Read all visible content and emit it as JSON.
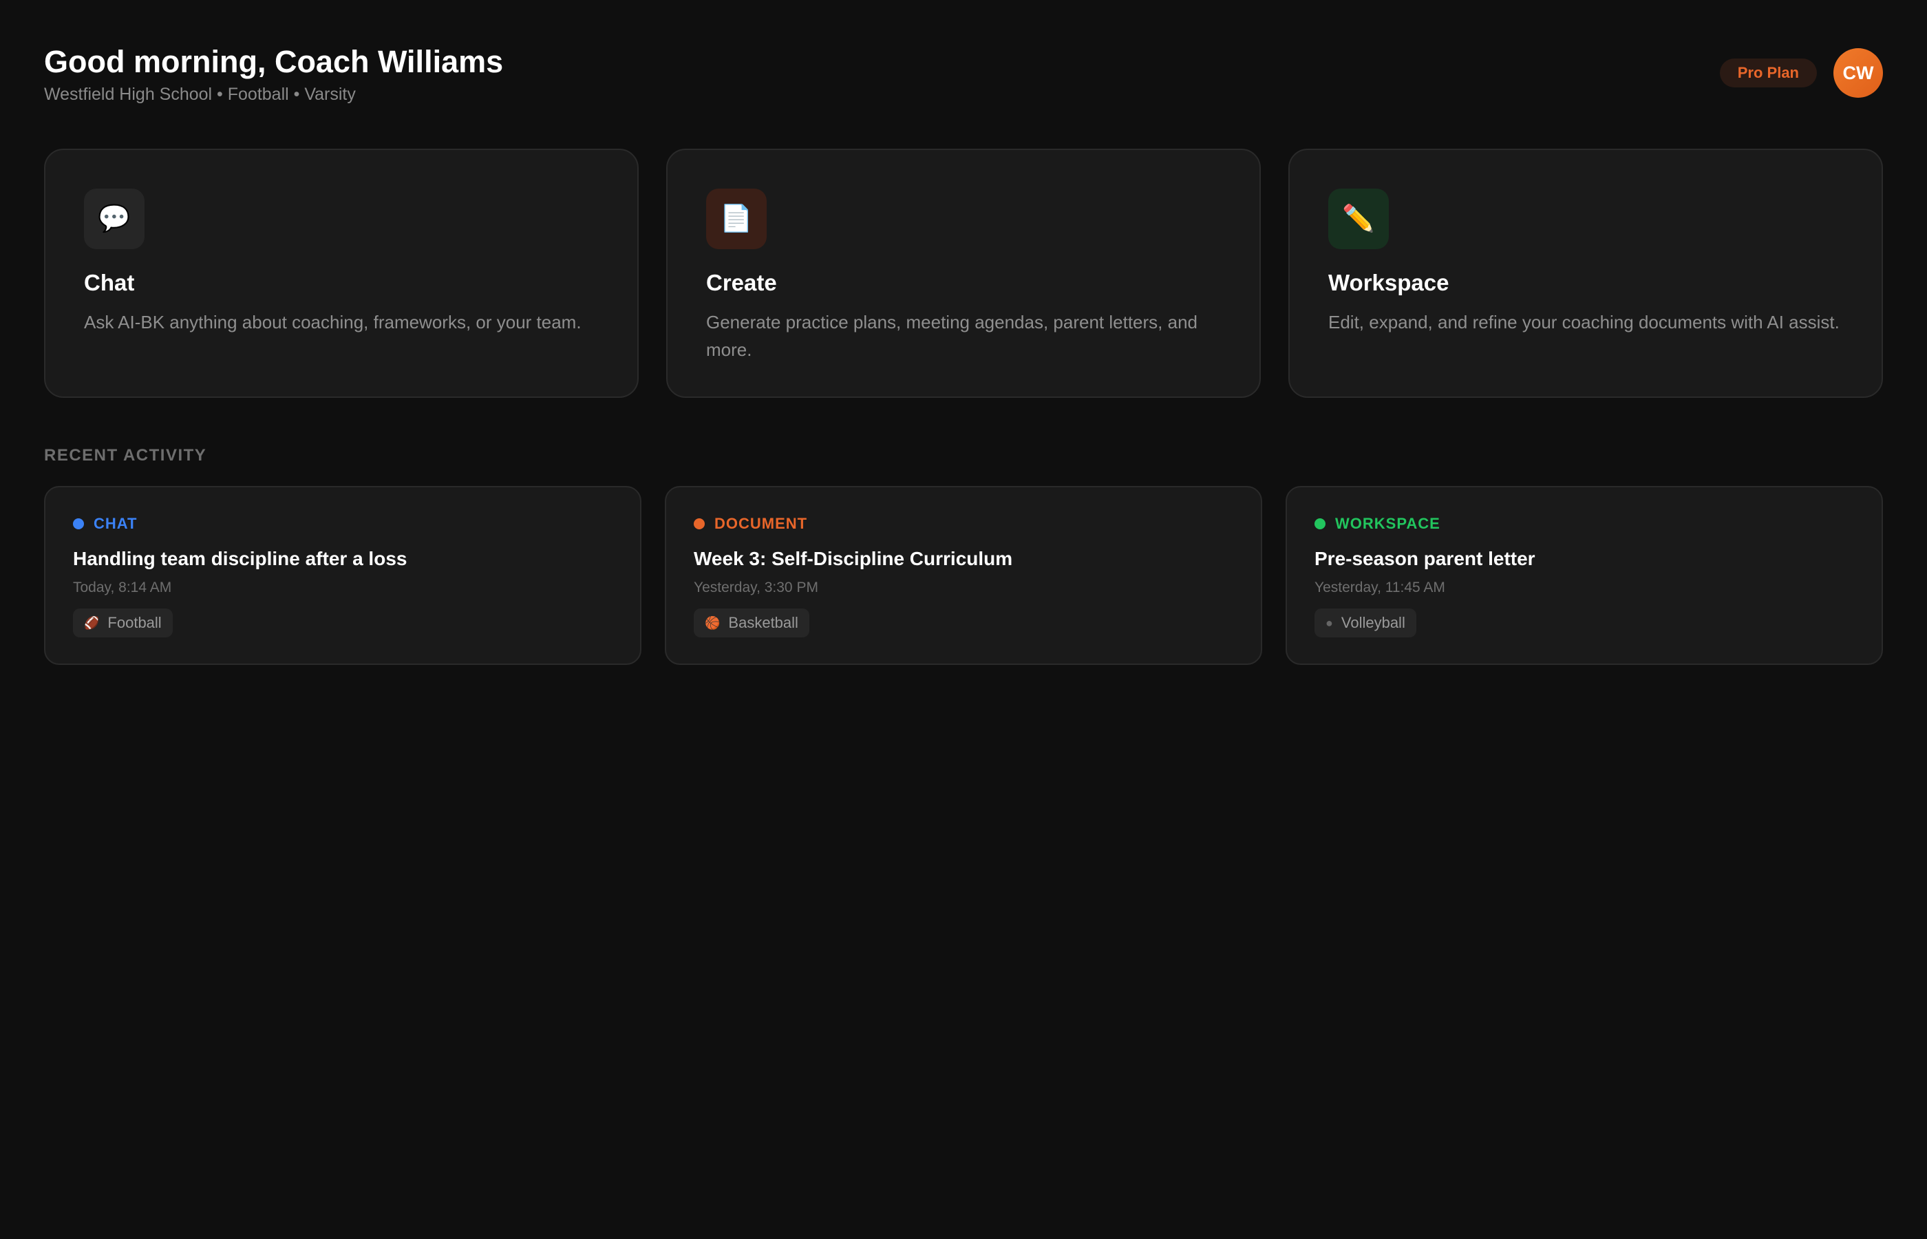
{
  "header": {
    "greeting": "Good morning, Coach Williams",
    "subtitle": "Westfield High School • Football • Varsity",
    "plan_badge": "Pro Plan",
    "avatar_initials": "CW"
  },
  "actions": [
    {
      "icon": "💬",
      "icon_name": "chat-bubble-icon",
      "title": "Chat",
      "description": "Ask AI-BK anything about coaching, frameworks, or your team."
    },
    {
      "icon": "📄",
      "icon_name": "document-icon",
      "title": "Create",
      "description": "Generate practice plans, meeting agendas, parent letters, and more."
    },
    {
      "icon": "✏️",
      "icon_name": "pencil-icon",
      "title": "Workspace",
      "description": "Edit, expand, and refine your coaching documents with AI assist."
    }
  ],
  "recent": {
    "section_label": "RECENT ACTIVITY",
    "items": [
      {
        "type": "CHAT",
        "type_color": "#3b82f6",
        "title": "Handling team discipline after a loss",
        "time": "Today, 8:14 AM",
        "tag_icon": "🏈",
        "tag_icon_name": "football-icon",
        "tag": "Football"
      },
      {
        "type": "DOCUMENT",
        "type_color": "#e8662a",
        "title": "Week 3: Self-Discipline Curriculum",
        "time": "Yesterday, 3:30 PM",
        "tag_icon": "🏀",
        "tag_icon_name": "basketball-icon",
        "tag": "Basketball"
      },
      {
        "type": "WORKSPACE",
        "type_color": "#22c55e",
        "title": "Pre-season parent letter",
        "time": "Yesterday, 11:45 AM",
        "tag_icon": "●",
        "tag_icon_name": "volleyball-icon",
        "tag": "Volleyball"
      }
    ]
  }
}
